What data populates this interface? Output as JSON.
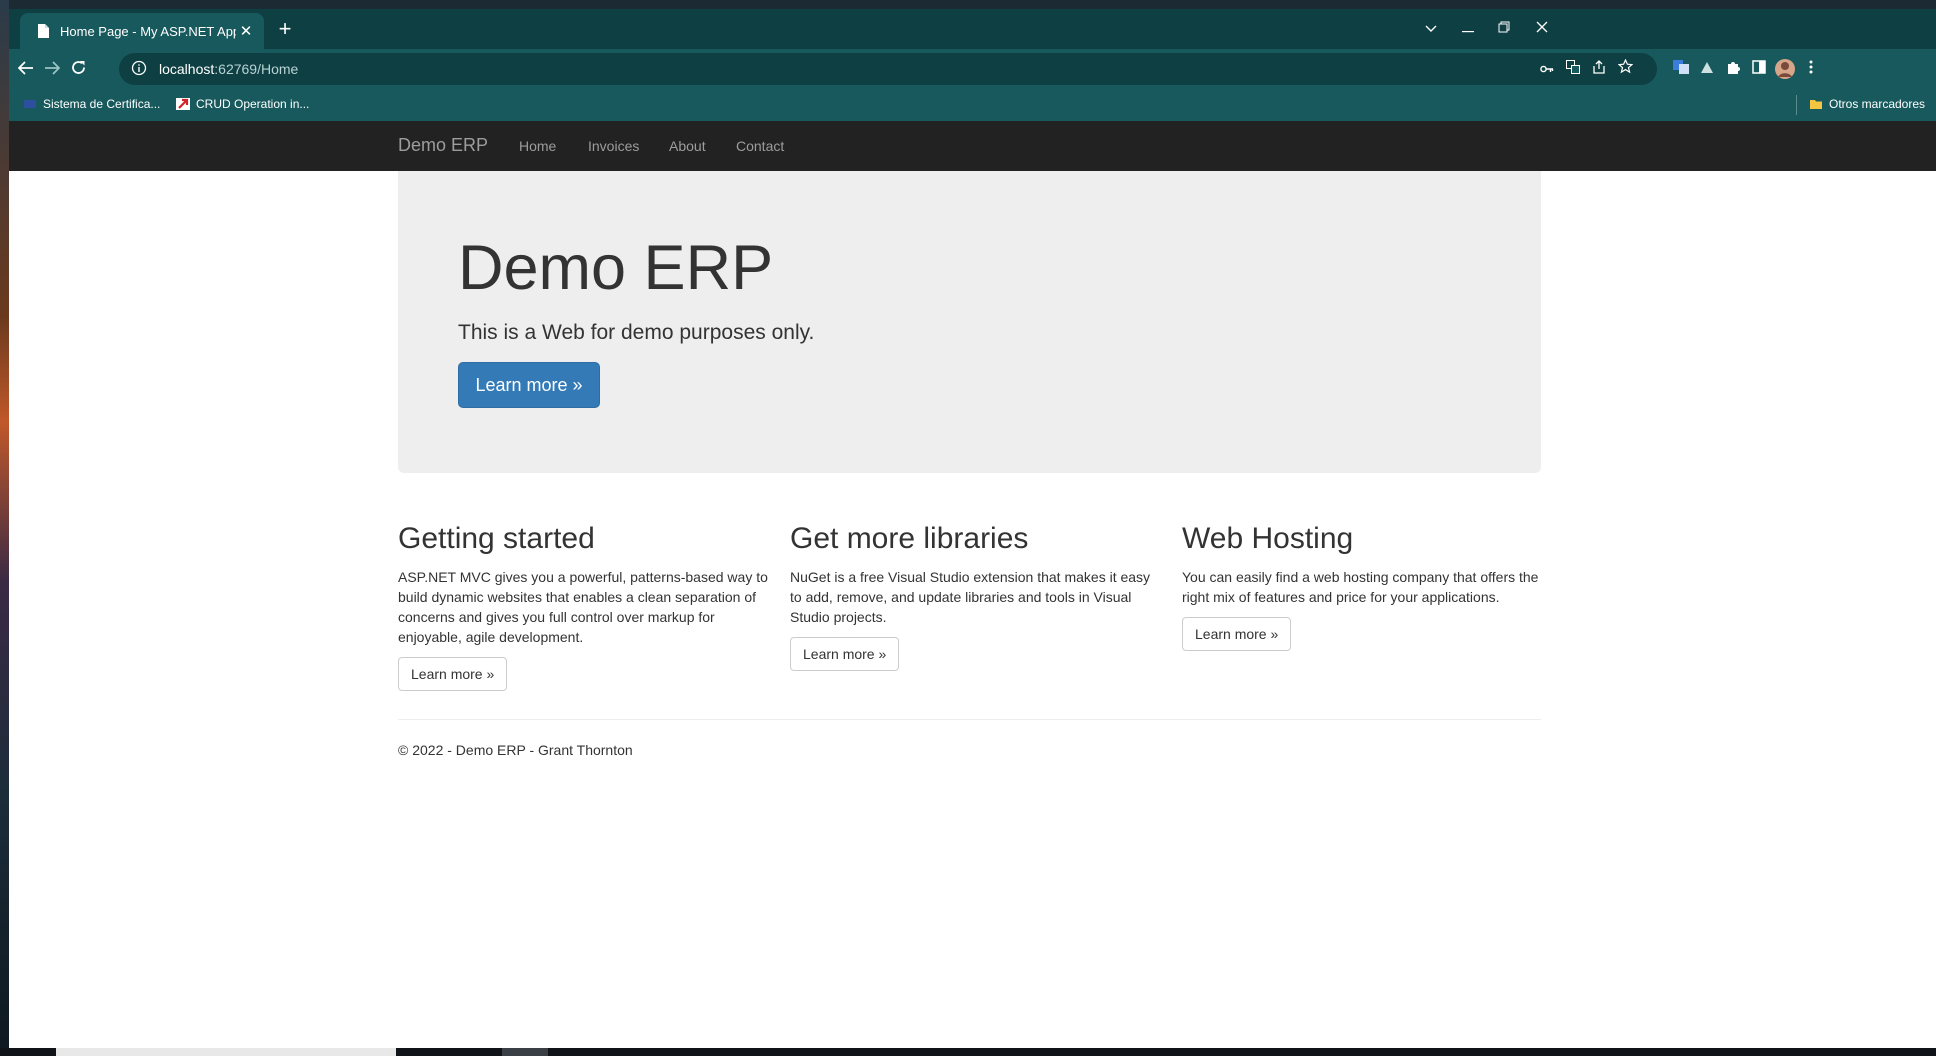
{
  "browser": {
    "tab_title": "Home Page - My ASP.NET Applic",
    "tab_close": "✕",
    "new_tab": "+",
    "url_host": "localhost",
    "url_rest": ":62769/Home",
    "bookmarks": [
      {
        "label": "Sistema de Certifica..."
      },
      {
        "label": "CRUD Operation in..."
      }
    ],
    "other_bookmarks": "Otros marcadores",
    "icons": {
      "back": "back-arrow-icon",
      "forward": "forward-arrow-icon",
      "reload": "reload-icon",
      "info": "info-icon",
      "key": "key-icon",
      "translate": "translate-icon",
      "share": "share-icon",
      "star": "star-icon",
      "extensions": "puzzle-icon",
      "sidepanel": "side-panel-icon",
      "profile": "avatar-icon",
      "menu": "kebab-menu-icon"
    },
    "colors": {
      "frame": "#0e3f43",
      "toolbar": "#17595c"
    }
  },
  "site": {
    "brand": "Demo ERP",
    "nav": [
      "Home",
      "Invoices",
      "About",
      "Contact"
    ]
  },
  "hero": {
    "title": "Demo ERP",
    "lead": "This is a Web for demo purposes only.",
    "button": "Learn more »"
  },
  "columns": [
    {
      "heading": "Getting started",
      "text": "ASP.NET MVC gives you a powerful, patterns-based way to build dynamic websites that enables a clean separation of concerns and gives you full control over markup for enjoyable, agile development.",
      "button": "Learn more »"
    },
    {
      "heading": "Get more libraries",
      "text": "NuGet is a free Visual Studio extension that makes it easy to add, remove, and update libraries and tools in Visual Studio projects.",
      "button": "Learn more »"
    },
    {
      "heading": "Web Hosting",
      "text": "You can easily find a web hosting company that offers the right mix of features and price for your applications.",
      "button": "Learn more »"
    }
  ],
  "footer": "© 2022 - Demo ERP - Grant Thornton"
}
